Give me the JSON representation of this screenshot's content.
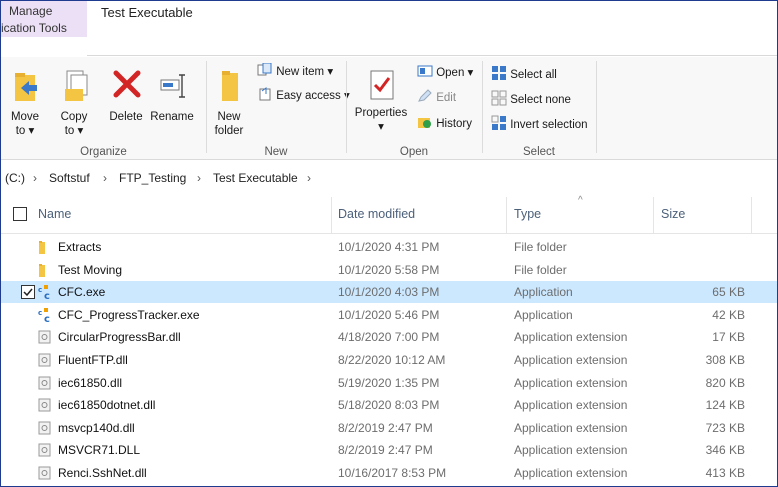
{
  "titlebar": {
    "context_tab_label": "Manage",
    "context_tab_sub": "ication Tools",
    "window_title": "Test Executable"
  },
  "ribbon": {
    "organize": {
      "group_label": "Organize",
      "move_label": "Move",
      "move_to": "to",
      "copy_label": "Copy",
      "copy_to": "to",
      "delete_label": "Delete",
      "rename_label": "Rename"
    },
    "new": {
      "group_label": "New",
      "new_folder_line1": "New",
      "new_folder_line2": "folder",
      "new_item": "New item",
      "easy_access": "Easy access"
    },
    "open": {
      "group_label": "Open",
      "properties": "Properties",
      "open": "Open",
      "edit": "Edit",
      "history": "History"
    },
    "select": {
      "group_label": "Select",
      "select_all": "Select all",
      "select_none": "Select none",
      "invert_selection": "Invert selection"
    }
  },
  "breadcrumb": {
    "drive": "(C:)",
    "items": [
      "Softstuf",
      "FTP_Testing",
      "Test Executable"
    ]
  },
  "columns": {
    "name": "Name",
    "date": "Date modified",
    "type": "Type",
    "size": "Size"
  },
  "files": [
    {
      "name": "Extracts",
      "date": "10/1/2020 4:31 PM",
      "type": "File folder",
      "size": "",
      "icon": "folder-icon"
    },
    {
      "name": "Test Moving",
      "date": "10/1/2020 5:58 PM",
      "type": "File folder",
      "size": "",
      "icon": "folder-icon"
    },
    {
      "name": "CFC.exe",
      "date": "10/1/2020 4:03 PM",
      "type": "Application",
      "size": "65 KB",
      "icon": "app-icon",
      "selected": true
    },
    {
      "name": "CFC_ProgressTracker.exe",
      "date": "10/1/2020 5:46 PM",
      "type": "Application",
      "size": "42 KB",
      "icon": "app-icon"
    },
    {
      "name": "CircularProgressBar.dll",
      "date": "4/18/2020 7:00 PM",
      "type": "Application extension",
      "size": "17 KB",
      "icon": "dll-icon"
    },
    {
      "name": "FluentFTP.dll",
      "date": "8/22/2020 10:12 AM",
      "type": "Application extension",
      "size": "308 KB",
      "icon": "dll-icon"
    },
    {
      "name": "iec61850.dll",
      "date": "5/19/2020 1:35 PM",
      "type": "Application extension",
      "size": "820 KB",
      "icon": "dll-icon"
    },
    {
      "name": "iec61850dotnet.dll",
      "date": "5/18/2020 8:03 PM",
      "type": "Application extension",
      "size": "124 KB",
      "icon": "dll-icon"
    },
    {
      "name": "msvcp140d.dll",
      "date": "8/2/2019 2:47 PM",
      "type": "Application extension",
      "size": "723 KB",
      "icon": "dll-icon"
    },
    {
      "name": "MSVCR71.DLL",
      "date": "8/2/2019 2:47 PM",
      "type": "Application extension",
      "size": "346 KB",
      "icon": "dll-icon"
    },
    {
      "name": "Renci.SshNet.dll",
      "date": "10/16/2017 8:53 PM",
      "type": "Application extension",
      "size": "413 KB",
      "icon": "dll-icon"
    }
  ]
}
